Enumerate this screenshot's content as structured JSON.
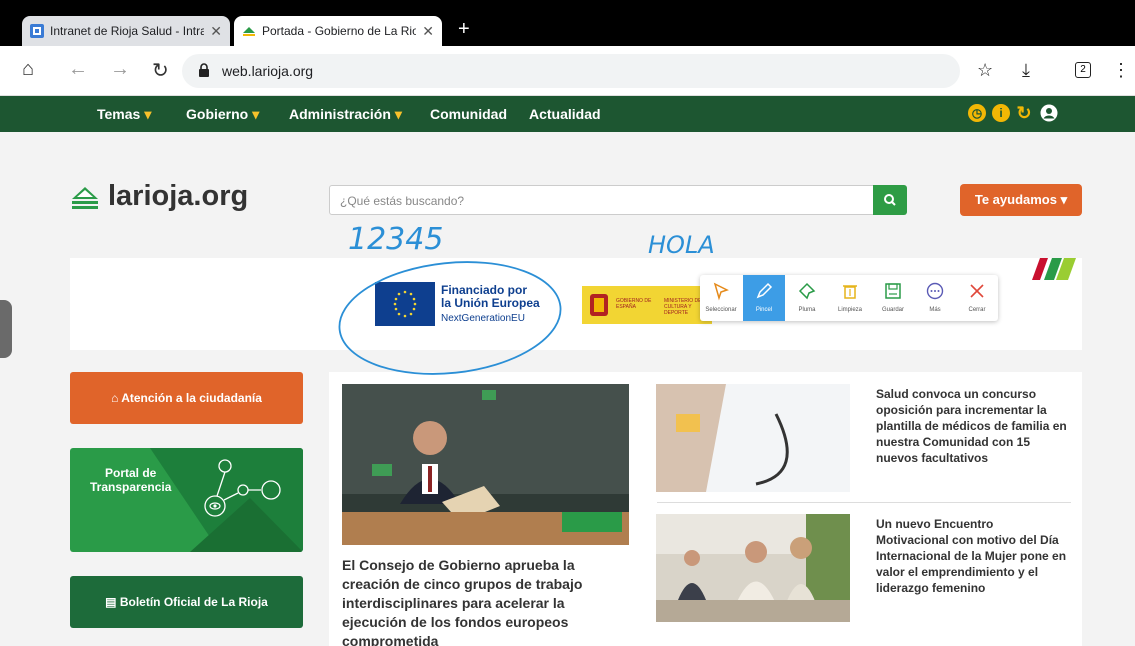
{
  "browser": {
    "tabs": [
      {
        "title": "Intranet de Rioja Salud - Intra",
        "active": false
      },
      {
        "title": "Portada - Gobierno de La Rio",
        "active": true
      }
    ],
    "new_tab_label": "+",
    "url": "web.larioja.org",
    "tab_count": "2"
  },
  "site_nav": {
    "items": [
      {
        "label": "Temas",
        "has_dropdown": true
      },
      {
        "label": "Gobierno",
        "has_dropdown": true
      },
      {
        "label": "Administración",
        "has_dropdown": true
      },
      {
        "label": "Comunidad",
        "has_dropdown": false
      },
      {
        "label": "Actualidad",
        "has_dropdown": false
      }
    ],
    "chevron": "⌄"
  },
  "header": {
    "brand": "larioja.org",
    "search_placeholder": "¿Qué estás buscando?",
    "help_label": "Te ayudamos",
    "help_chevron": "⌄"
  },
  "banner": {
    "eu_line1": "Financiado por",
    "eu_line2": "la Unión Europea",
    "eu_line3": "NextGenerationEU",
    "gov_text1": "GOBIERNO DE ESPAÑA",
    "gov_text2": "MINISTERIO DE CULTURA Y DEPORTE"
  },
  "annotation_toolbar": {
    "tools": [
      {
        "label": "Seleccionar",
        "active": false
      },
      {
        "label": "Pincel",
        "active": true
      },
      {
        "label": "Pluma",
        "active": false
      },
      {
        "label": "Limpieza",
        "active": false
      },
      {
        "label": "Guardar",
        "active": false
      },
      {
        "label": "Más",
        "active": false
      },
      {
        "label": "Cerrar",
        "active": false
      }
    ]
  },
  "handwriting": {
    "numbers": "12345",
    "word": "HOLA"
  },
  "sidebar": {
    "attention": "Atención a la ciudadanía",
    "transparency_line1": "Portal de",
    "transparency_line2": "Transparencia",
    "bulletin": "Boletín Oficial de La Rioja"
  },
  "news": {
    "main_headline": "El Consejo de Gobierno aprueba la creación de cinco grupos de trabajo interdisciplinares para acelerar la ejecución de los fondos europeos comprometida",
    "side_items": [
      {
        "headline": "Salud convoca un concurso oposición para incrementar la plantilla de médicos de familia en nuestra Comunidad con 15 nuevos facultativos"
      },
      {
        "headline": "Un nuevo Encuentro Motivacional con motivo del Día Internacional de la Mujer pone en valor el emprendimiento y el liderazgo femenino"
      }
    ]
  },
  "colors": {
    "nav_green": "#1d5631",
    "accent_orange": "#e0642a",
    "accent_yellow": "#f2b705",
    "search_green": "#2e9c45",
    "eu_blue": "#0e3f8f",
    "ink_blue": "#2b8fd6"
  }
}
